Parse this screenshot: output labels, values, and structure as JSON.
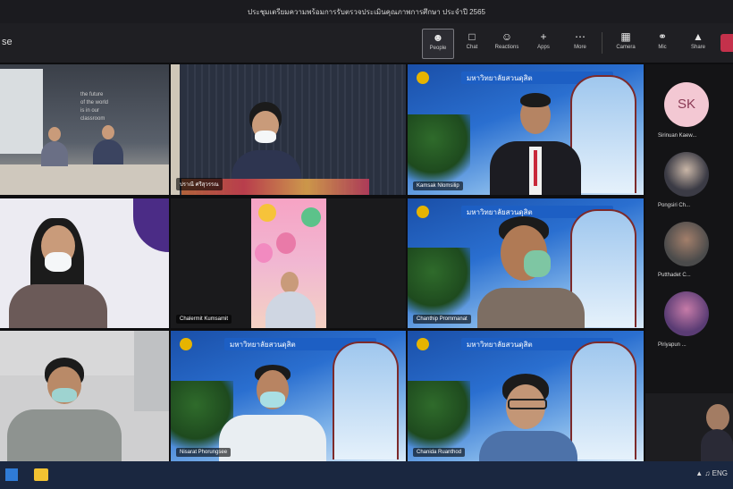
{
  "window": {
    "title": "ประชุมเตรียมความพร้อมการรับตรวจประเมินคุณภาพการศึกษา ประจำปี 2565"
  },
  "toolbar": {
    "meeting_label": "se",
    "buttons": [
      {
        "id": "people",
        "label": "People",
        "icon": "people-icon"
      },
      {
        "id": "chat",
        "label": "Chat",
        "icon": "chat-icon"
      },
      {
        "id": "reactions",
        "label": "Reactions",
        "icon": "reactions-icon"
      },
      {
        "id": "apps",
        "label": "Apps",
        "icon": "add-icon"
      },
      {
        "id": "more",
        "label": "More",
        "icon": "more-icon"
      },
      {
        "id": "camera",
        "label": "Camera",
        "icon": "camera-icon"
      },
      {
        "id": "mic",
        "label": "Mic",
        "icon": "mic-icon"
      },
      {
        "id": "share",
        "label": "Share",
        "icon": "share-icon"
      }
    ]
  },
  "banner_text": "มหาวิทยาลัยสวนดุสิต",
  "video_tiles": [
    {
      "name": "",
      "bg": "room"
    },
    {
      "name": "ปราณี ศรีสุวรรณ",
      "bg": "room-dark"
    },
    {
      "name": "Kamsak Nlomsilip",
      "bg": "university"
    },
    {
      "name": "",
      "bg": "light"
    },
    {
      "name": "Chalermit Kumsamit",
      "bg": "balloons"
    },
    {
      "name": "Chanthip Prommanat",
      "bg": "university"
    },
    {
      "name": "",
      "bg": "office"
    },
    {
      "name": "Nisarat Phorungsee",
      "bg": "university"
    },
    {
      "name": "Chanida Ruanthod",
      "bg": "university"
    }
  ],
  "side_participants": [
    {
      "initials": "SK",
      "name": "Sirinuan Kaew..."
    },
    {
      "initials": "",
      "name": "Pongsiri Ch..."
    },
    {
      "initials": "",
      "name": "Putthadet C..."
    },
    {
      "initials": "",
      "name": "Piriyapun ..."
    }
  ],
  "tray": {
    "lang": "ENG"
  },
  "colors": {
    "accent": "#6264a7",
    "leave": "#c4314b",
    "taskbar": "#1a2740"
  }
}
